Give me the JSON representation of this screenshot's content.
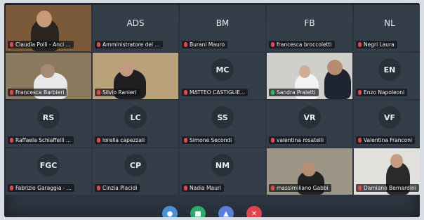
{
  "participants": [
    {
      "name": "Claudia Polli - Anci ...",
      "initials": "",
      "video": true,
      "mic": "muted"
    },
    {
      "name": "Amministratore del ...",
      "initials": "ADS",
      "video": false,
      "mic": "muted"
    },
    {
      "name": "Burani Mauro",
      "initials": "BM",
      "video": false,
      "mic": "muted"
    },
    {
      "name": "francesca broccoletti",
      "initials": "FB",
      "video": false,
      "mic": "muted"
    },
    {
      "name": "Negri Laura",
      "initials": "NL",
      "video": false,
      "mic": "muted"
    },
    {
      "name": "Francesca Barbieri",
      "initials": "",
      "video": true,
      "mic": "muted"
    },
    {
      "name": "Silvio Ranieri",
      "initials": "",
      "video": true,
      "mic": "muted"
    },
    {
      "name": "MATTEO CASTIGLIE...",
      "initials": "MC",
      "video": false,
      "mic": "muted"
    },
    {
      "name": "Sandra Praletti",
      "initials": "",
      "video": true,
      "mic": "on"
    },
    {
      "name": "Enzo Napoleoni",
      "initials": "EN",
      "video": false,
      "mic": "muted"
    },
    {
      "name": "Raffaela Schiaffelli ...",
      "initials": "RS",
      "video": false,
      "mic": "muted"
    },
    {
      "name": "lorella capezzali",
      "initials": "LC",
      "video": false,
      "mic": "muted"
    },
    {
      "name": "Simone Secondi",
      "initials": "SS",
      "video": false,
      "mic": "muted"
    },
    {
      "name": "valentina rosatelli",
      "initials": "VR",
      "video": false,
      "mic": "muted"
    },
    {
      "name": "Valentina Franconi",
      "initials": "VF",
      "video": false,
      "mic": "muted"
    },
    {
      "name": "Fabrizio Garaggia - ...",
      "initials": "FGC",
      "video": false,
      "mic": "muted"
    },
    {
      "name": "Cinzia Placidi",
      "initials": "CP",
      "video": false,
      "mic": "muted"
    },
    {
      "name": "Nadia Mauri",
      "initials": "NM",
      "video": false,
      "mic": "muted"
    },
    {
      "name": "massimiliano Gabbi",
      "initials": "",
      "video": true,
      "mic": "muted"
    },
    {
      "name": "Damiano Bernardini",
      "initials": "",
      "video": true,
      "mic": "muted"
    }
  ],
  "controls": [
    {
      "icon": "microphone-icon",
      "color": "#4a90d9"
    },
    {
      "icon": "camera-icon",
      "color": "#2faa6a"
    },
    {
      "icon": "share-screen-icon",
      "color": "#5a7fd6"
    },
    {
      "icon": "hang-up-icon",
      "color": "#e0454f"
    }
  ]
}
